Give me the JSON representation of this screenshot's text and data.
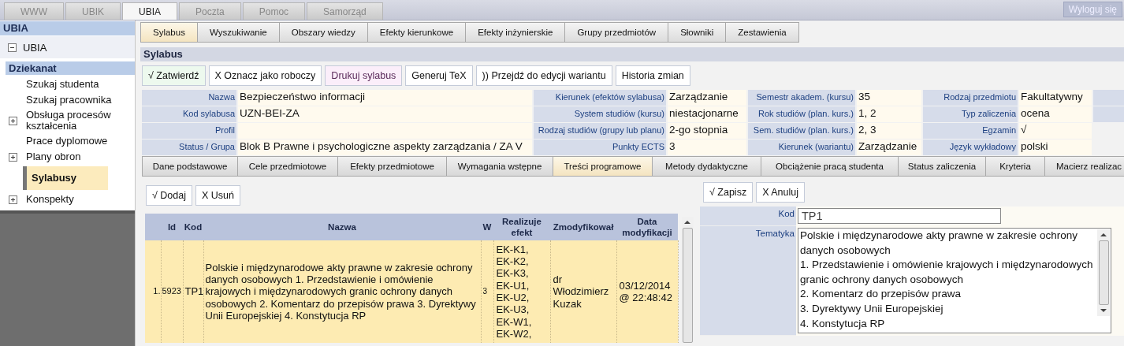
{
  "top_tabs": [
    {
      "label": "WWW",
      "selected": false
    },
    {
      "label": "UBIK",
      "selected": false
    },
    {
      "label": "UBIA",
      "selected": true
    },
    {
      "label": "Poczta",
      "selected": false
    },
    {
      "label": "Pomoc",
      "selected": false
    },
    {
      "label": "Samorząd",
      "selected": false
    }
  ],
  "logout_button": "Wyloguj się",
  "sidebar": {
    "title": "UBIA",
    "root": {
      "label": "UBIA",
      "expanded": true
    },
    "sections": [
      {
        "title": "Dziekanat",
        "items": [
          {
            "label": "Szukaj studenta",
            "kind": "page",
            "selected": false
          },
          {
            "label": "Szukaj pracownika",
            "kind": "page",
            "selected": false
          },
          {
            "label": "Obsługa procesów kształcenia",
            "kind": "folder",
            "expanded": false,
            "selected": false
          },
          {
            "label": "Prace dyplomowe",
            "kind": "page",
            "selected": false
          },
          {
            "label": "Plany obron",
            "kind": "folder",
            "expanded": false,
            "selected": false
          },
          {
            "label": "Sylabusy",
            "kind": "page",
            "selected": true
          },
          {
            "label": "Konspekty",
            "kind": "folder",
            "expanded": false,
            "selected": false
          }
        ]
      }
    ]
  },
  "module_tabs": [
    {
      "label": "Sylabus",
      "selected": true
    },
    {
      "label": "Wyszukiwanie",
      "selected": false
    },
    {
      "label": "Obszary wiedzy",
      "selected": false
    },
    {
      "label": "Efekty kierunkowe",
      "selected": false
    },
    {
      "label": "Efekty inżynierskie",
      "selected": false
    },
    {
      "label": "Grupy przedmiotów",
      "selected": false
    },
    {
      "label": "Słowniki",
      "selected": false
    },
    {
      "label": "Zestawienia",
      "selected": false
    }
  ],
  "panel_title": "Sylabus",
  "toolbar": [
    {
      "label": "√ Zatwierdź",
      "kind": "confirm"
    },
    {
      "label": "X Oznacz jako roboczy",
      "kind": "plain"
    },
    {
      "label": "Drukuj sylabus",
      "kind": "print"
    },
    {
      "label": "Generuj TeX",
      "kind": "plain"
    },
    {
      "label": ")) Przejdź do edycji wariantu",
      "kind": "plain"
    },
    {
      "label": "Historia zmian",
      "kind": "plain"
    }
  ],
  "details": [
    [
      {
        "label": "Nazwa",
        "value": "Bezpieczeństwo informacji"
      },
      {
        "label": "Kierunek (efektów sylabusa)",
        "value": "Zarządzanie"
      },
      {
        "label": "Semestr akadem. (kursu)",
        "value": "35"
      },
      {
        "label": "Rodzaj przedmiotu",
        "value": "Fakultatywny"
      }
    ],
    [
      {
        "label": "Kod sylabusa",
        "value": "UZN-BEI-ZA"
      },
      {
        "label": "System studiów (kursu)",
        "value": "niestacjonarne"
      },
      {
        "label": "Rok studiów (plan. kurs.)",
        "value": "1, 2"
      },
      {
        "label": "Typ zaliczenia",
        "value": "ocena"
      }
    ],
    [
      {
        "label": "Profil"
      },
      {
        "label": "Rodzaj studiów (grupy lub planu)",
        "value": "2-go stopnia"
      },
      {
        "label": "Sem. studiów (plan. kurs.)",
        "value": "2, 3"
      },
      {
        "label": "Egzamin",
        "value": "√"
      }
    ],
    [
      {
        "label": "Status / Grupa",
        "value": "Blok B Prawne i psychologiczne aspekty zarządzania / ZA V"
      },
      {
        "label": "Punkty ECTS",
        "value": "3"
      },
      {
        "label": "Kierunek (wariantu)",
        "value": "Zarządzanie"
      },
      {
        "label": "Język wykładowy",
        "value": "polski"
      }
    ]
  ],
  "section_tabs": [
    {
      "label": "Dane podstawowe",
      "selected": false
    },
    {
      "label": "Cele przedmiotowe",
      "selected": false
    },
    {
      "label": "Efekty przedmiotowe",
      "selected": false
    },
    {
      "label": "Wymagania wstępne",
      "selected": false
    },
    {
      "label": "Treści programowe",
      "selected": true
    },
    {
      "label": "Metody dydaktyczne",
      "selected": false
    },
    {
      "label": "Obciążenie pracą studenta",
      "selected": false
    },
    {
      "label": "Status zaliczenia",
      "selected": false
    },
    {
      "label": "Kryteria",
      "selected": false
    },
    {
      "label": "Macierz realizac",
      "selected": false
    }
  ],
  "list_buttons": [
    "√ Dodaj",
    "X Usuń"
  ],
  "table": {
    "columns": [
      "Id",
      "Kod",
      "Nazwa",
      "W",
      "Realizuje efekt",
      "Zmodyfikował",
      "Data modyfikacji"
    ],
    "rows": [
      {
        "number": "1.",
        "selected": true,
        "cells": [
          "5923",
          "TP1",
          "Polskie i międzynarodowe akty prawne w zakresie ochrony danych osobowych 1. Przedstawienie i omówienie krajowych i międzynarodowych granic ochrony danych osobowych 2. Komentarz do przepisów prawa 3. Dyrektywy Unii Europejskiej 4. Konstytucja RP",
          "3",
          "EK-K1, EK-K2, EK-K3, EK-U1, EK-U2, EK-U3, EK-W1, EK-W2,",
          "dr Włodzimierz Kuzak",
          "03/12/2014 @ 22:48:42"
        ]
      }
    ]
  },
  "form_buttons": [
    "√ Zapisz",
    "X Anuluj"
  ],
  "form": [
    {
      "label": "Kod",
      "kind": "input",
      "value": "TP1"
    },
    {
      "label": "Tematyka",
      "kind": "textarea",
      "value": "Polskie i międzynarodowe akty prawne w zakresie ochrony danych osobowych\n1. Przedstawienie i omówienie krajowych i międzynarodowych granic ochrony danych osobowych\n2. Komentarz do przepisów prawa\n3. Dyrektywy Unii Europejskiej\n4. Konstytucja RP"
    }
  ]
}
